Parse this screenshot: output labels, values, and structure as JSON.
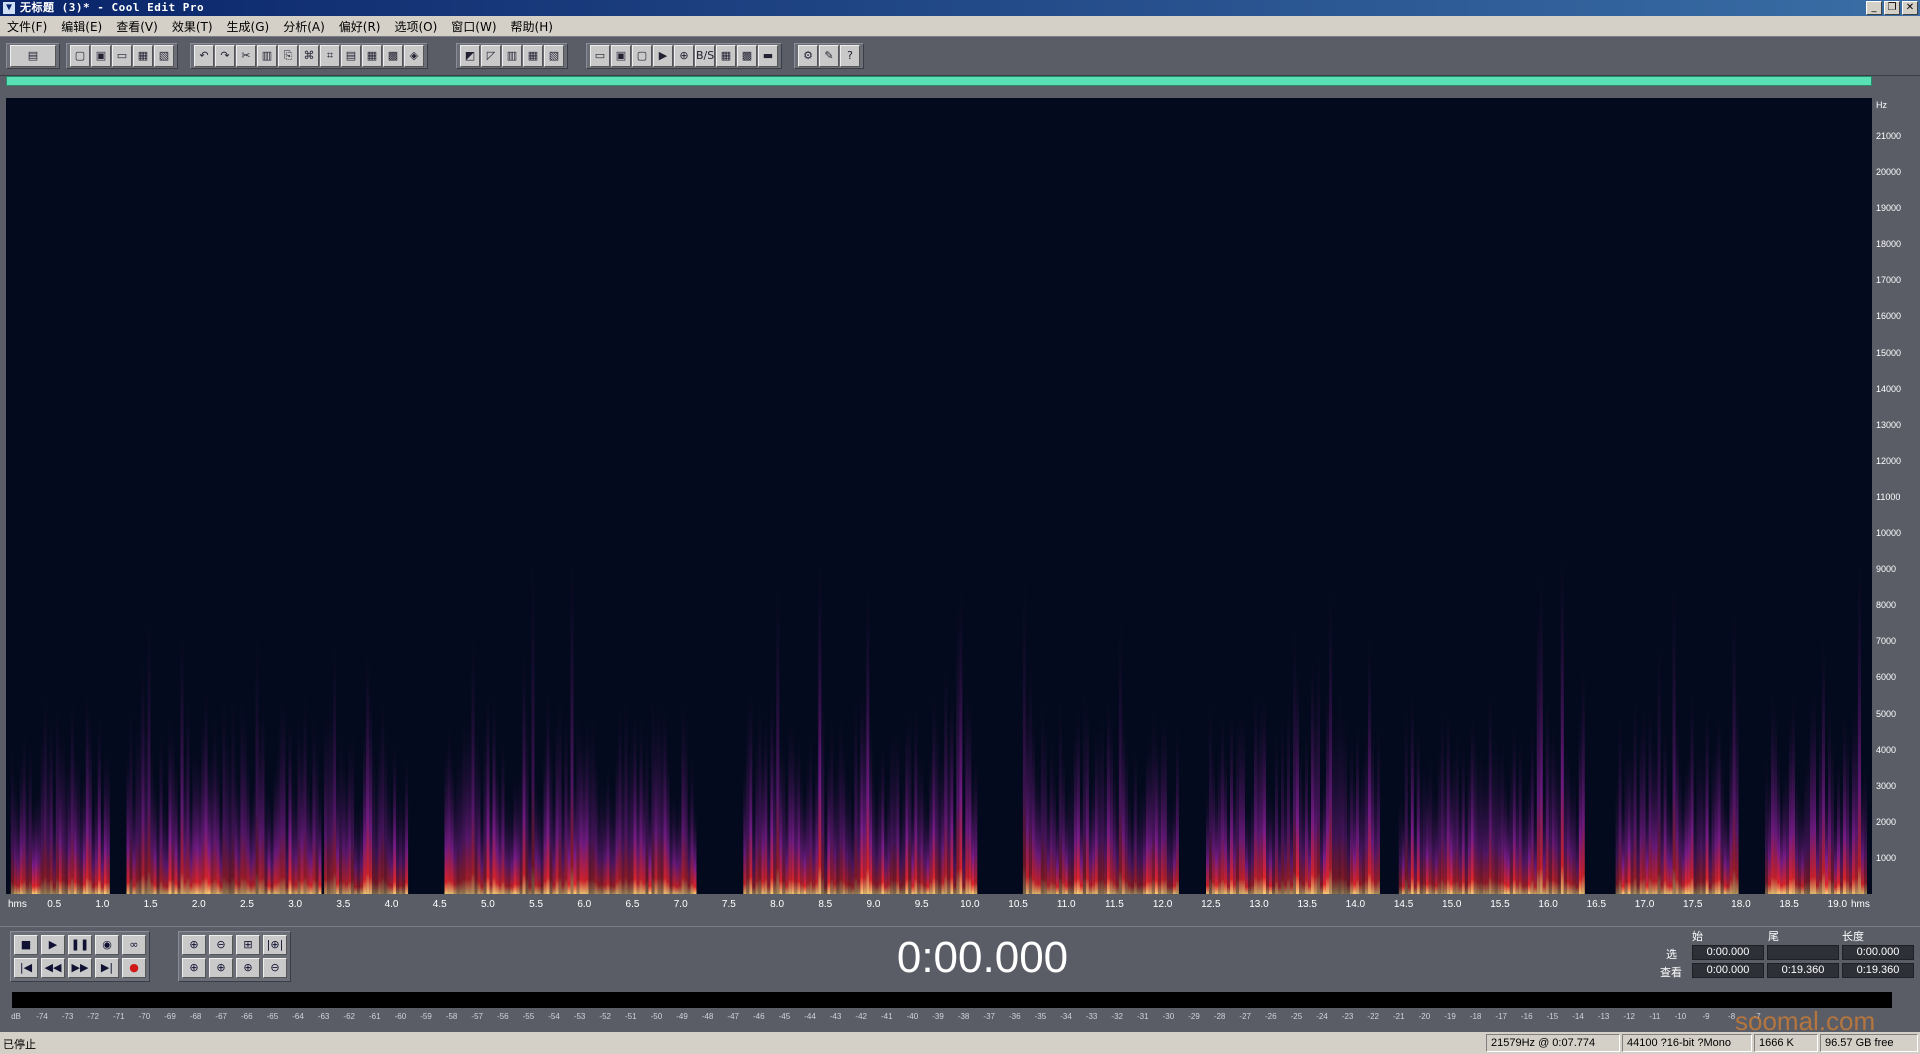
{
  "window": {
    "title": "无标题 (3)* - Cool Edit Pro",
    "app_icon": "▼",
    "controls": [
      "_",
      "❐",
      "✕"
    ]
  },
  "menubar": {
    "items": [
      "文件(F)",
      "编辑(E)",
      "查看(V)",
      "效果(T)",
      "生成(G)",
      "分析(A)",
      "偏好(R)",
      "选项(O)",
      "窗口(W)",
      "帮助(H)"
    ]
  },
  "toolbar": {
    "groups": [
      {
        "icons": [
          "▤"
        ],
        "wide": true
      },
      {
        "icons": [
          "▢",
          "▣",
          "▭",
          "▦",
          "▧"
        ]
      },
      {
        "icons": [
          "↶",
          "↷",
          "✂",
          "▥",
          "⎘",
          "⌘",
          "⌗",
          "▤",
          "▦",
          "▩",
          "◈"
        ]
      },
      {
        "icons": [
          "◩",
          "◸",
          "▥",
          "▦",
          "▧"
        ]
      },
      {
        "icons": [
          "▭",
          "▣",
          "▢",
          "▶",
          "⊕",
          "B/S",
          "▦",
          "▩",
          "▬"
        ]
      },
      {
        "icons": [
          "⚙",
          "✎",
          "?"
        ]
      }
    ]
  },
  "colors": {
    "spectrogram_bg": "#040a1e",
    "progress": "#59e0b4",
    "hot": "#ffd27a",
    "mid": "#e0242c",
    "cool": "#7a1c8a"
  },
  "spectrum": {
    "hz_unit": "Hz",
    "hz_labels": [
      "21000",
      "20000",
      "19000",
      "18000",
      "17000",
      "16000",
      "15000",
      "14000",
      "13000",
      "12000",
      "11000",
      "10000",
      "9000",
      "8000",
      "7000",
      "6000",
      "5000",
      "4000",
      "3000",
      "2000",
      "1000"
    ],
    "hz_values": [
      21000,
      20000,
      19000,
      18000,
      17000,
      16000,
      15000,
      14000,
      13000,
      12000,
      11000,
      10000,
      9000,
      8000,
      7000,
      6000,
      5000,
      4000,
      3000,
      2000,
      1000
    ],
    "max_hz": 22050,
    "duration_s": 19.36,
    "speech_segments": [
      {
        "start": 0.05,
        "end": 1.05
      },
      {
        "start": 1.25,
        "end": 3.25
      },
      {
        "start": 3.3,
        "end": 4.15
      },
      {
        "start": 4.55,
        "end": 7.15
      },
      {
        "start": 7.65,
        "end": 10.05
      },
      {
        "start": 10.55,
        "end": 12.15
      },
      {
        "start": 12.45,
        "end": 14.25
      },
      {
        "start": 14.45,
        "end": 16.35
      },
      {
        "start": 16.7,
        "end": 17.95
      },
      {
        "start": 18.25,
        "end": 19.3
      }
    ]
  },
  "timeline": {
    "start_label": "hms",
    "end_label": "hms",
    "ticks": [
      "0.5",
      "1.0",
      "1.5",
      "2.0",
      "2.5",
      "3.0",
      "3.5",
      "4.0",
      "4.5",
      "5.0",
      "5.5",
      "6.0",
      "6.5",
      "7.0",
      "7.5",
      "8.0",
      "8.5",
      "9.0",
      "9.5",
      "10.0",
      "10.5",
      "11.0",
      "11.5",
      "12.0",
      "12.5",
      "13.0",
      "13.5",
      "14.0",
      "14.5",
      "15.0",
      "15.5",
      "16.0",
      "16.5",
      "17.0",
      "17.5",
      "18.0",
      "18.5",
      "19.0"
    ],
    "tick_values": [
      0.5,
      1.0,
      1.5,
      2.0,
      2.5,
      3.0,
      3.5,
      4.0,
      4.5,
      5.0,
      5.5,
      6.0,
      6.5,
      7.0,
      7.5,
      8.0,
      8.5,
      9.0,
      9.5,
      10.0,
      10.5,
      11.0,
      11.5,
      12.0,
      12.5,
      13.0,
      13.5,
      14.0,
      14.5,
      15.0,
      15.5,
      16.0,
      16.5,
      17.0,
      17.5,
      18.0,
      18.5,
      19.0
    ]
  },
  "transport": {
    "row1": [
      "■",
      "▶",
      "❚❚",
      "◉",
      "∞"
    ],
    "row2": [
      "|◀",
      "◀◀",
      "▶▶",
      "▶|",
      "●"
    ],
    "zoom_row1": [
      "⊕",
      "⊖",
      "⊞",
      "|⊕|"
    ],
    "zoom_row2": [
      "⊕",
      "⊕",
      "⊕",
      "⊖"
    ]
  },
  "time_display": "0:00.000",
  "selection": {
    "headers": [
      "始",
      "尾",
      "长度"
    ],
    "rows": [
      {
        "label": "选",
        "begin": "0:00.000",
        "end": "",
        "length": "0:00.000"
      },
      {
        "label": "查看",
        "begin": "0:00.000",
        "end": "0:19.360",
        "length": "0:19.360"
      }
    ]
  },
  "level_meter": {
    "start_label": "dB",
    "labels": [
      "-74",
      "-73",
      "-72",
      "-71",
      "-70",
      "-69",
      "-68",
      "-67",
      "-66",
      "-65",
      "-64",
      "-63",
      "-62",
      "-61",
      "-60",
      "-59",
      "-58",
      "-57",
      "-56",
      "-55",
      "-54",
      "-53",
      "-52",
      "-51",
      "-50",
      "-49",
      "-48",
      "-47",
      "-46",
      "-45",
      "-44",
      "-43",
      "-42",
      "-41",
      "-40",
      "-39",
      "-38",
      "-37",
      "-36",
      "-35",
      "-34",
      "-33",
      "-32",
      "-31",
      "-30",
      "-29",
      "-28",
      "-27",
      "-26",
      "-25",
      "-24",
      "-23",
      "-22",
      "-21",
      "-20",
      "-19",
      "-18",
      "-17",
      "-16",
      "-15",
      "-14",
      "-13",
      "-12",
      "-11",
      "-10",
      "-9",
      "-8",
      "-7"
    ]
  },
  "status": {
    "state": "已停止",
    "cursor": "21579Hz @  0:07.774",
    "format": "44100 ?16-bit ?Mono",
    "size": "1666 K",
    "free": "96.57 GB free"
  },
  "watermark": "soomal.com"
}
